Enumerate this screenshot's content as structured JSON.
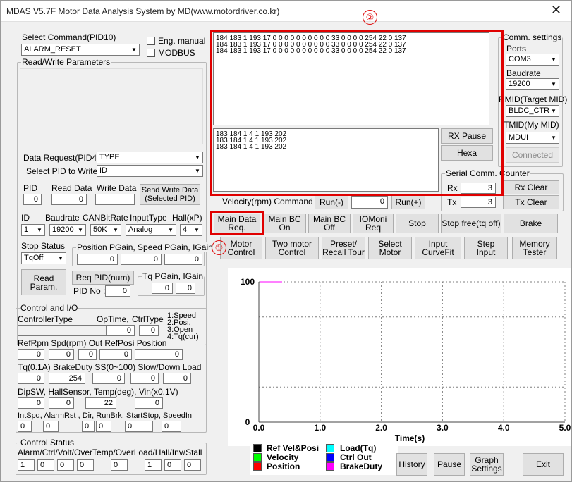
{
  "window": {
    "title": "MDAS V5.7F Motor Data Analysis System by MD(www.motordriver.co.kr)",
    "close_glyph": "✕"
  },
  "annotations": {
    "marker1": "①",
    "marker2": "②"
  },
  "left": {
    "select_command": {
      "label": "Select Command(PID10)",
      "value": "ALARM_RESET"
    },
    "eng_manual": "Eng. manual",
    "modbus": "MODBUS",
    "rw_params_title": "Read/Write Parameters",
    "data_request": {
      "label": "Data Request(PID4)",
      "value": "TYPE"
    },
    "select_pid_write": {
      "label": "Select PID to Write",
      "value": "ID"
    },
    "pid_label": "PID",
    "pid_value": "0",
    "read_data_label": "Read Data",
    "read_data_value": "0",
    "write_data_label": "Write Data",
    "write_data_value": "",
    "send_write_btn": "Send Write Data\n(Selected PID)",
    "id_label": "ID",
    "id_value": "1",
    "baud_label": "Baudrate",
    "baud_value": "19200",
    "canbit_label": "CANBitRate",
    "canbit_value": "50K",
    "input_type_label": "InputType",
    "input_type_value": "Analog",
    "hall_label": "Hall(xP)",
    "hall_value": "4",
    "stop_status_label": "Stop Status",
    "stop_status_value": "TqOff",
    "gain_title": "Position PGain, Speed PGain, IGain",
    "gain_values": [
      "0",
      "0",
      "0"
    ],
    "read_param_btn": "Read\nParam.",
    "req_pid_btn": "Req PID(num)",
    "pid_no_label": "PID No :",
    "pid_no_value": "0",
    "tq_gain_title": "Tq PGain, IGain",
    "tq_gain_values": [
      "0",
      "0"
    ],
    "control_io": {
      "title": "Control and I/O",
      "controller_type": "ControllerType",
      "optime": "OpTime,",
      "ctrltype": "CtrlType",
      "optime_value": "0",
      "ctrltype_value": "0",
      "ctrl_notes": "1:Speed\n2:Posi,\n3:Open\n4:Tq(cur)",
      "row1_label": "RefRpm  Spd(rpm)  Out  RefPosi      Position",
      "row1_values": [
        "0",
        "0",
        "0",
        "0",
        "0"
      ],
      "row2_label": "Tq(0.1A)  BrakeDuty  SS(0~100)  Slow/Down  Load",
      "row2_values": [
        "0",
        "254",
        "0",
        "0",
        "0"
      ],
      "row3_label": "DipSW, HallSensor,    Temp(deg), Vin(x0.1V)",
      "row3_values": [
        "0",
        "0",
        "22",
        "0"
      ],
      "row4_label": "IntSpd, AlarmRst , Dir, RunBrk, StartStop, SpeedIn",
      "row4_values": [
        "0",
        "0",
        "0",
        "0",
        "0",
        "0"
      ]
    },
    "control_status": {
      "title": "Control Status",
      "label": "Alarm/Ctrl/Volt/OverTemp/OverLoad/Hall/Inv/Stall",
      "values": [
        "1",
        "0",
        "0",
        "0",
        "0",
        "1",
        "0",
        "0"
      ]
    }
  },
  "serial": {
    "rx_text": "184 183 1 193 17 0 0 0 0 0 0 0 0 0 0 33 0 0 0 0 254 22 0 137\n184 183 1 193 17 0 0 0 0 0 0 0 0 0 0 33 0 0 0 0 254 22 0 137\n184 183 1 193 17 0 0 0 0 0 0 0 0 0 0 33 0 0 0 0 254 22 0 137",
    "tx_text": "183 184 1 4 1 193 202\n183 184 1 4 1 193 202\n183 184 1 4 1 193 202",
    "rx_pause": "RX Pause",
    "hexa": "Hexa",
    "counter_title": "Serial Comm. Counter",
    "rx_label": "Rx",
    "rx_value": "3",
    "tx_label": "Tx",
    "tx_value": "3",
    "rx_clear": "Rx Clear",
    "tx_clear": "Tx Clear"
  },
  "comm": {
    "title": "Comm. settings",
    "ports_label": "Ports",
    "ports_value": "COM3",
    "baud_label": "Baudrate",
    "baud_value": "19200",
    "rmid_label": "RMID(Target MID)",
    "rmid_value": "BLDC_CTR",
    "tmid_label": "TMID(My MID)",
    "tmid_value": "MDUI",
    "connected": "Connected"
  },
  "velocity": {
    "label": "Velocity(rpm) Command",
    "run_minus": "Run(-)",
    "value": "0",
    "run_plus": "Run(+)"
  },
  "buttons_row1": [
    "Main Data\nReq.",
    "Main BC\nOn",
    "Main BC\nOff",
    "IOMoni\nReq",
    "Stop",
    "Stop free(tq off)",
    "Brake"
  ],
  "buttons_row2": [
    "Motor\nControl",
    "Two motor\nControl",
    "Preset/\nRecall Tour",
    "Select\nMotor",
    "Input\nCurveFit",
    "Step\nInput",
    "Memory\nTester"
  ],
  "chart_data": {
    "type": "line",
    "xlabel": "Time(s)",
    "ylabel": "",
    "xlim": [
      0,
      5
    ],
    "ylim": [
      0,
      100
    ],
    "x_ticks": [
      "0.0",
      "1.0",
      "2.0",
      "3.0",
      "4.0",
      "5.0"
    ],
    "y_ticks": [
      "100",
      "0"
    ],
    "grid": true,
    "series": []
  },
  "legend": {
    "items": [
      {
        "name": "Ref Vel&Posi",
        "color": "#000000"
      },
      {
        "name": "Velocity",
        "color": "#00ff00"
      },
      {
        "name": "Position",
        "color": "#ff0000"
      },
      {
        "name": "Load(Tq)",
        "color": "#00ffff"
      },
      {
        "name": "Ctrl Out",
        "color": "#0000ff"
      },
      {
        "name": "BrakeDuty",
        "color": "#ff00ff"
      }
    ]
  },
  "bottom_buttons": {
    "history": "History",
    "pause": "Pause",
    "graph_settings": "Graph\nSettings",
    "exit": "Exit"
  }
}
